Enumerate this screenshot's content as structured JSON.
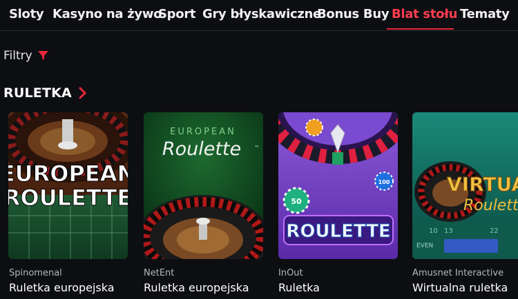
{
  "nav": {
    "tabs": [
      {
        "label": "Sloty",
        "active": false
      },
      {
        "label": "Kasyno na żywo",
        "active": false
      },
      {
        "label": "Sport",
        "active": false
      },
      {
        "label": "Gry błyskawiczne",
        "active": false
      },
      {
        "label": "Bonus Buy",
        "active": false
      },
      {
        "label": "Blat stołu",
        "active": true
      },
      {
        "label": "Tematy",
        "active": false
      }
    ]
  },
  "filters": {
    "label": "Filtry",
    "icon": "filter-icon"
  },
  "section": {
    "title": "RULETKA",
    "icon": "chevron-right-icon"
  },
  "games": [
    {
      "provider": "Spinomenal",
      "name": "Ruletka europejska",
      "art": [
        "EUROPEAN",
        "ROULETTE"
      ]
    },
    {
      "provider": "NetEnt",
      "name": "Ruletka europejska",
      "art": [
        "EUROPEAN",
        "Roulette",
        "™"
      ]
    },
    {
      "provider": "InOut",
      "name": "Ruletka",
      "art": [
        "ROULETTE",
        "50",
        "100"
      ]
    },
    {
      "provider": "Amusnet Interactive",
      "name": "Wirtualna ruletka",
      "art": [
        "VIRTUA",
        "Roulett",
        "EVEN",
        "10",
        "13",
        "22"
      ]
    }
  ],
  "colors": {
    "accent": "#e8283a",
    "background": "#0d0e12"
  }
}
